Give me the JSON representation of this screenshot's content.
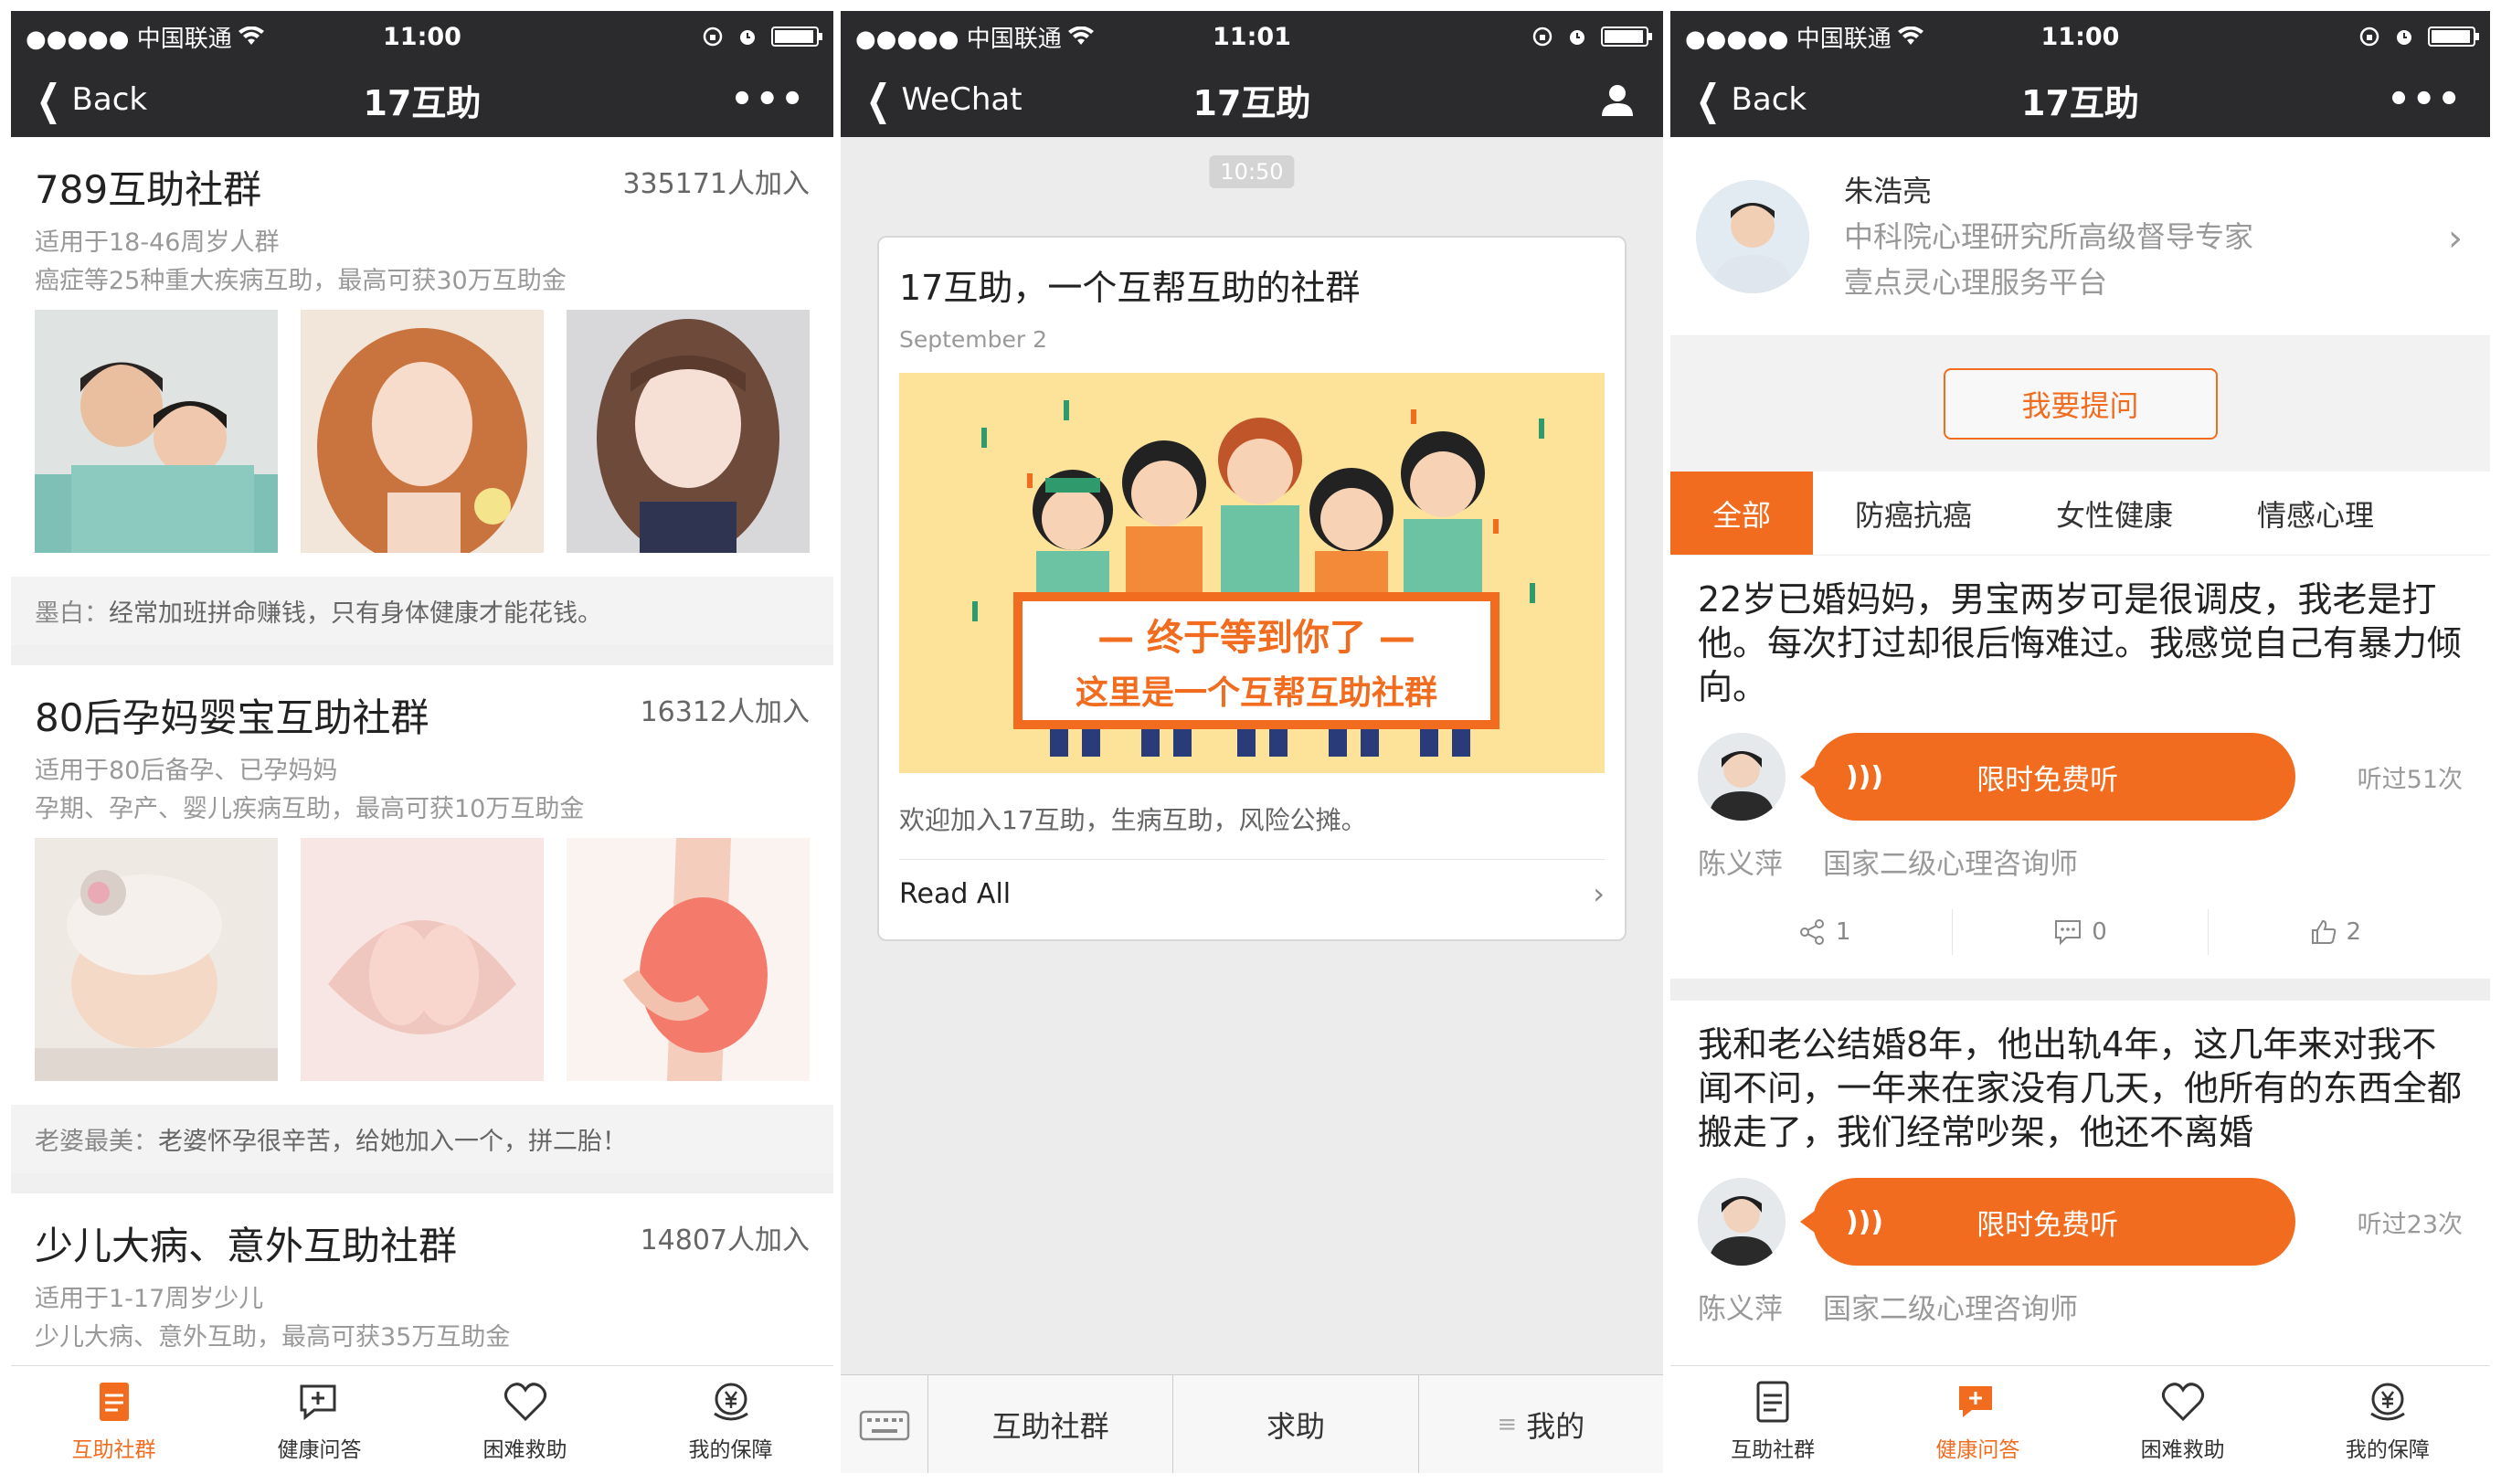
{
  "status_bars": [
    {
      "carrier": "●●●●● 中国联通",
      "time": "11:00"
    },
    {
      "carrier": "●●●●● 中国联通",
      "time": "11:01"
    },
    {
      "carrier": "●●●●● 中国联通",
      "time": "11:00"
    }
  ],
  "screen1": {
    "nav": {
      "back": "Back",
      "title": "17互助",
      "more": "•••"
    },
    "groups": [
      {
        "title": "789互助社群",
        "count": "335171人加入",
        "desc1": "适用于18-46周岁人群",
        "desc2": "癌症等25种重大疾病互助，最高可获30万互助金",
        "quote_who": "墨白：",
        "quote": "经常加班拼命赚钱，只有身体健康才能花钱。"
      },
      {
        "title": "80后孕妈婴宝互助社群",
        "count": "16312人加入",
        "desc1": "适用于80后备孕、已孕妈妈",
        "desc2": "孕期、孕产、婴儿疾病互助，最高可获10万互助金",
        "quote_who": "老婆最美：",
        "quote": "老婆怀孕很辛苦，给她加入一个，拼二胎！"
      },
      {
        "title": "少儿大病、意外互助社群",
        "count": "14807人加入",
        "desc1": "适用于1-17周岁少儿",
        "desc2": "少儿大病、意外互助，最高可获35万互助金"
      }
    ],
    "tabs": [
      {
        "label": "互助社群",
        "icon": "document-icon"
      },
      {
        "label": "健康问答",
        "icon": "chat-plus-icon"
      },
      {
        "label": "困难救助",
        "icon": "heart-icon"
      },
      {
        "label": "我的保障",
        "icon": "yuan-shield-icon"
      }
    ]
  },
  "screen2": {
    "nav": {
      "back": "WeChat",
      "title": "17互助"
    },
    "time_chip": "10:50",
    "card": {
      "title": "17互助，一个互帮互助的社群",
      "date": "September 2",
      "banner_line1": "— 终于等到你了 —",
      "banner_line2": "这里是一个互帮互助社群",
      "text": "欢迎加入17互助，生病互助，风险公摊。",
      "read_all": "Read All"
    },
    "menu": [
      "互助社群",
      "求助",
      "我的"
    ],
    "menu_lines": "≡"
  },
  "screen3": {
    "nav": {
      "back": "Back",
      "title": "17互助",
      "more": "•••"
    },
    "expert": {
      "name": "朱浩亮",
      "line1": "中科院心理研究所高级督导专家",
      "line2": "壹点灵心理服务平台"
    },
    "ask": "我要提问",
    "categories": [
      "全部",
      "防癌抗癌",
      "女性健康",
      "情感心理"
    ],
    "questions": [
      {
        "text": "22岁已婚妈妈，男宝两岁可是很调皮，我老是打他。每次打过却很后悔难过。我感觉自己有暴力倾向。",
        "listen": "限时免费听",
        "heard": "听过51次",
        "author": "陈义萍",
        "role": "国家二级心理咨询师",
        "share": "1",
        "comments": "0",
        "likes": "2"
      },
      {
        "text": "我和老公结婚8年，他出轨4年，这几年来对我不闻不问，一年来在家没有几天，他所有的东西全都搬走了，我们经常吵架，他还不离婚",
        "listen": "限时免费听",
        "heard": "听过23次",
        "author": "陈义萍",
        "role": "国家二级心理咨询师"
      }
    ],
    "tabs": [
      {
        "label": "互助社群",
        "icon": "document-icon"
      },
      {
        "label": "健康问答",
        "icon": "chat-plus-icon"
      },
      {
        "label": "困难救助",
        "icon": "heart-icon"
      },
      {
        "label": "我的保障",
        "icon": "yuan-shield-icon"
      }
    ]
  },
  "colors": {
    "accent": "#f26c1f",
    "navbar": "#2b2b2d",
    "banner": "#fde39a"
  }
}
